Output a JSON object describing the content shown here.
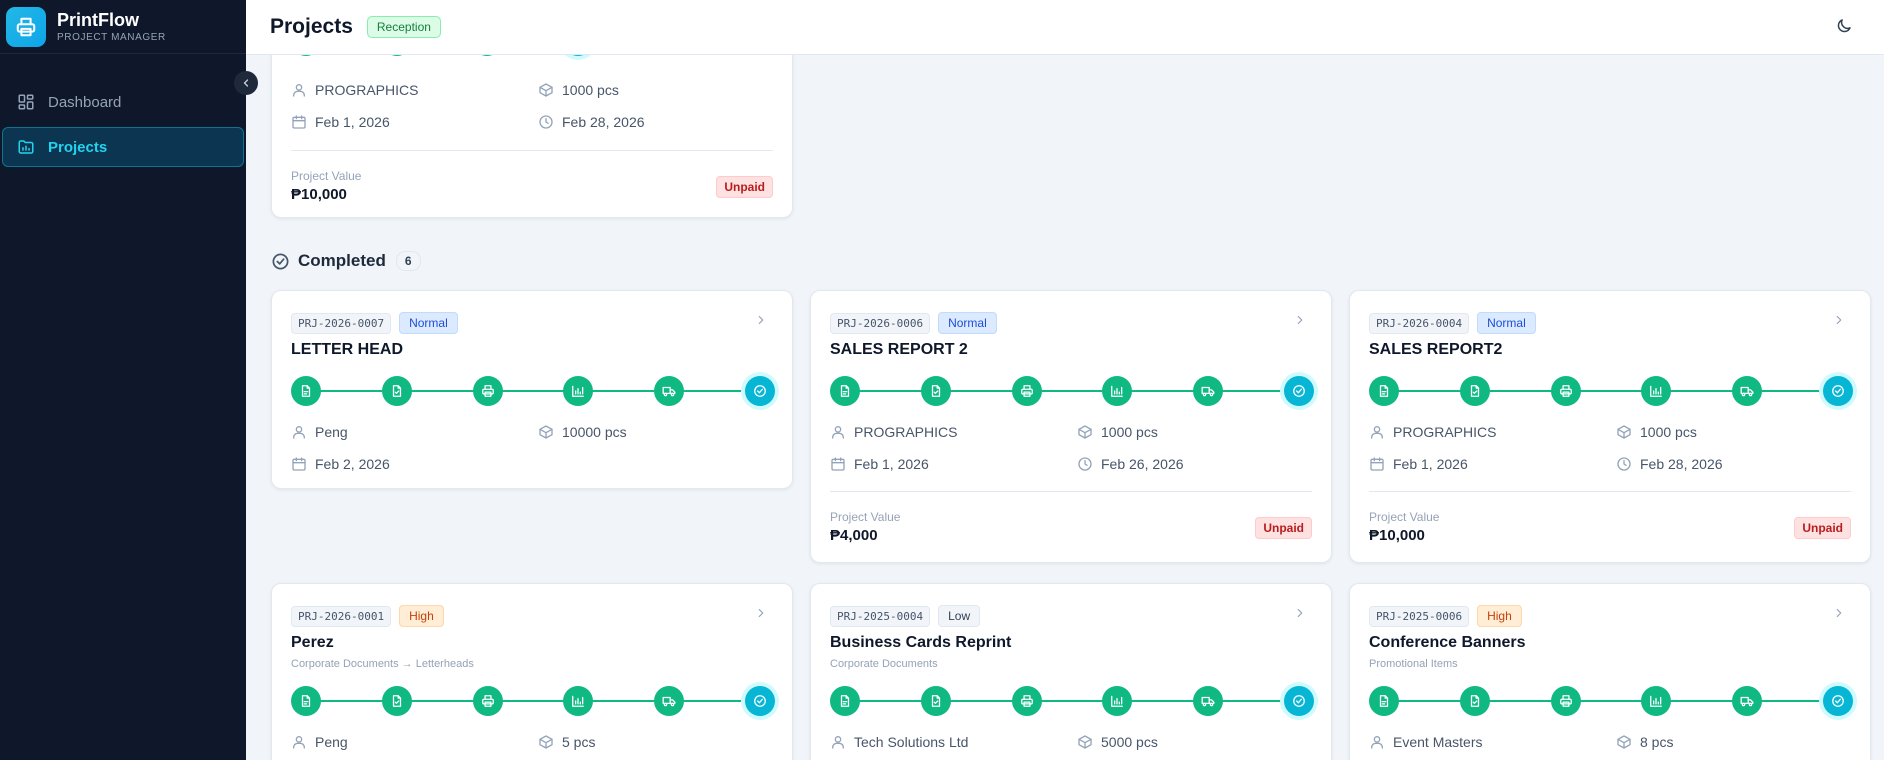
{
  "app": {
    "name": "PrintFlow",
    "subtitle": "PROJECT MANAGER"
  },
  "sidebar": {
    "items": [
      {
        "label": "Dashboard",
        "icon": "grid-icon"
      },
      {
        "label": "Projects",
        "icon": "folder-chart-icon",
        "active": true
      }
    ]
  },
  "header": {
    "title": "Projects",
    "role_badge": "Reception"
  },
  "colors": {
    "sidebar_bg": "#0f172a",
    "accent": "#22d3ee",
    "step_done": "#10b981",
    "step_final": "#06b6d4",
    "unpaid": "#b91c1c"
  },
  "top_card": {
    "client": "PROGRAPHICS",
    "quantity": "1000 pcs",
    "start_date": "Feb 1, 2026",
    "due_date": "Feb 28, 2026",
    "value_label": "Project Value",
    "value": "₱10,000",
    "payment_status": "Unpaid"
  },
  "section": {
    "title": "Completed",
    "count": "6"
  },
  "cards": [
    {
      "code": "PRJ-2026-0007",
      "priority": "Normal",
      "title": "LETTER HEAD",
      "subtitle": "",
      "client": "Peng",
      "quantity": "10000 pcs",
      "start_date": "Feb 2, 2026",
      "due_date": ""
    },
    {
      "code": "PRJ-2026-0006",
      "priority": "Normal",
      "title": "SALES REPORT 2",
      "subtitle": "",
      "client": "PROGRAPHICS",
      "quantity": "1000 pcs",
      "start_date": "Feb 1, 2026",
      "due_date": "Feb 26, 2026",
      "value_label": "Project Value",
      "value": "₱4,000",
      "payment_status": "Unpaid"
    },
    {
      "code": "PRJ-2026-0004",
      "priority": "Normal",
      "title": "SALES REPORT2",
      "subtitle": "",
      "client": "PROGRAPHICS",
      "quantity": "1000 pcs",
      "start_date": "Feb 1, 2026",
      "due_date": "Feb 28, 2026",
      "value_label": "Project Value",
      "value": "₱10,000",
      "payment_status": "Unpaid"
    },
    {
      "code": "PRJ-2026-0001",
      "priority": "High",
      "title": "Perez",
      "subtitle": "Corporate Documents → Letterheads",
      "client": "Peng",
      "quantity": "5 pcs"
    },
    {
      "code": "PRJ-2025-0004",
      "priority": "Low",
      "title": "Business Cards Reprint",
      "subtitle": "Corporate Documents",
      "client": "Tech Solutions Ltd",
      "quantity": "5000 pcs"
    },
    {
      "code": "PRJ-2025-0006",
      "priority": "High",
      "title": "Conference Banners",
      "subtitle": "Promotional Items",
      "client": "Event Masters",
      "quantity": "8 pcs"
    }
  ],
  "workflow_steps": [
    "file-icon",
    "file-check-icon",
    "printer-icon",
    "chart-bar-icon",
    "truck-icon",
    "check-circle-icon"
  ]
}
